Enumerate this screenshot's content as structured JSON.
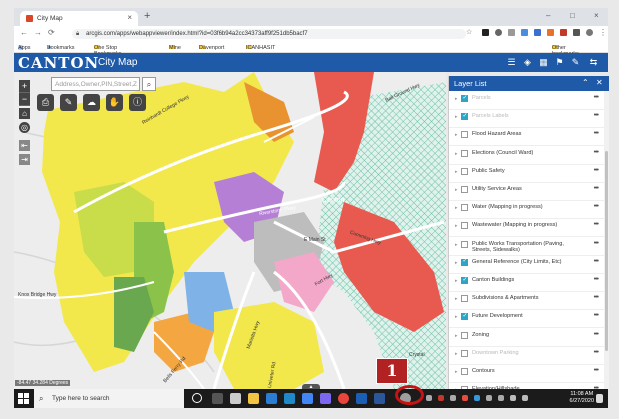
{
  "browser": {
    "tab_title": "City Map",
    "tab_close": "×",
    "new_tab": "+",
    "window_controls": [
      "–",
      "□",
      "×"
    ],
    "url": "arcgis.com/apps/webappviewer/index.html?id=03f6b94a2cc34373aff9f251db5bacf7",
    "bookmarks": [
      "Apps",
      "Bookmarks",
      "One Stop Bookmarks",
      "Mine",
      "Davenport",
      "ICANHASIT",
      "Other bookmarks"
    ]
  },
  "app": {
    "logo": "CANTON",
    "title": "City Map",
    "brand_color": "#1f5aa8"
  },
  "map": {
    "search_placeholder": "Address,Owner,PIN,Street,Z",
    "zoom_in": "+",
    "zoom_out": "−",
    "coordinates": "-84.47 34.284 Degrees",
    "labels": [
      "Reinhardt College Pkwy",
      "Riverstone Pkwy",
      "Canton",
      "Marietta Hwy",
      "Knox Bridge Hwy",
      "Bells Ferry Rd",
      "Cumming Hwy",
      "Ball Ground Hwy",
      "E Main St",
      "Univeter Rd",
      "Fort Hwy",
      "Crystal"
    ]
  },
  "layer_list": {
    "title": "Layer List",
    "items": [
      {
        "label": "Parcels",
        "checked": true,
        "disabled": true
      },
      {
        "label": "Parcels Labels",
        "checked": true,
        "disabled": true
      },
      {
        "label": "Flood Hazard Areas",
        "checked": false,
        "disabled": false
      },
      {
        "label": "Elections (Council Ward)",
        "checked": false,
        "disabled": false
      },
      {
        "label": "Public Safety",
        "checked": false,
        "disabled": false
      },
      {
        "label": "Utility Service Areas",
        "checked": false,
        "disabled": false
      },
      {
        "label": "Water (Mapping in progress)",
        "checked": false,
        "disabled": false
      },
      {
        "label": "Wastewater (Mapping in progress)",
        "checked": false,
        "disabled": false
      },
      {
        "label": "Public Works Transportation (Paving, Streets, Sidewalks)",
        "checked": false,
        "disabled": false
      },
      {
        "label": "General Reference (City Limits, Etc)",
        "checked": true,
        "disabled": false
      },
      {
        "label": "Canton Buildings",
        "checked": true,
        "disabled": false
      },
      {
        "label": "Subdivisions & Apartments",
        "checked": false,
        "disabled": false
      },
      {
        "label": "Future Development",
        "checked": true,
        "disabled": false
      },
      {
        "label": "Zoning",
        "checked": false,
        "disabled": false
      },
      {
        "label": "Downtown Parking",
        "checked": false,
        "disabled": true
      },
      {
        "label": "Contours",
        "checked": false,
        "disabled": false
      },
      {
        "label": "Elevation/Hillshade",
        "checked": false,
        "disabled": false
      }
    ],
    "more": "•••"
  },
  "taskbar": {
    "search_placeholder": "Type here to search",
    "time": "11:08 AM",
    "date": "6/27/2020"
  },
  "annotation": {
    "number": "1"
  }
}
